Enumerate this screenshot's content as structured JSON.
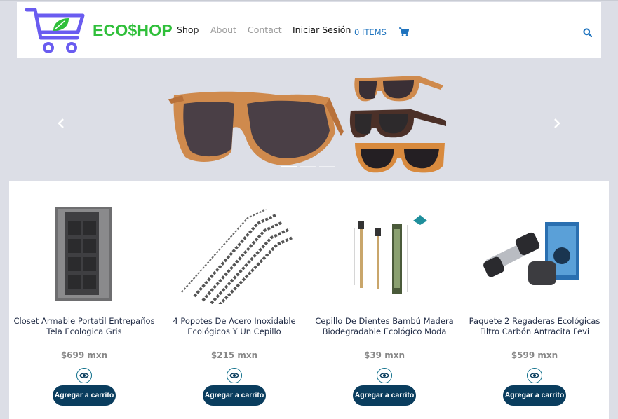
{
  "header": {
    "logo_text": "ECO$HOP",
    "nav": [
      "Shop",
      "About",
      "Contact",
      "Iniciar Sesión"
    ],
    "cart_label": "0 ITEMS"
  },
  "colors": {
    "brand_green": "#2fbf3a",
    "brand_purple": "#6a5cf0",
    "link_blue": "#1e73be",
    "button_navy": "#0a3d5e",
    "background": "#dcdee6"
  },
  "icons": {
    "cart": "shopping-cart-icon",
    "search": "search-icon",
    "prev": "chevron-left-icon",
    "next": "chevron-right-icon",
    "view": "eye-icon"
  },
  "carousel": {
    "slide_count": 3,
    "active_slide": 1
  },
  "products": [
    {
      "title": "Closet Armable Portatil Entrepaños Tela Ecologica Gris",
      "price": "$699 mxn",
      "add_label": "Agregar a carrito"
    },
    {
      "title": "4 Popotes De Acero Inoxidable Ecológicos Y Un Cepillo",
      "price": "$215 mxn",
      "add_label": "Agregar a carrito"
    },
    {
      "title": "Cepillo De Dientes Bambú Madera Biodegradable Ecológico Moda",
      "price": "$39 mxn",
      "add_label": "Agregar a carrito"
    },
    {
      "title": "Paquete 2 Regaderas Ecológicas Filtro Carbón Antracita Fevi",
      "price": "$599 mxn",
      "add_label": "Agregar a carrito"
    }
  ]
}
